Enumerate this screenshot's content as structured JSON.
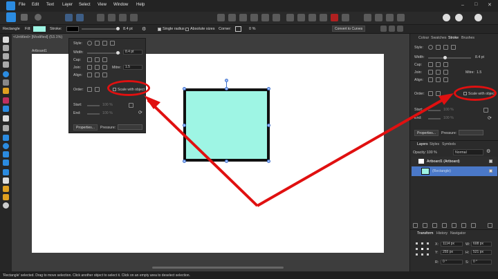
{
  "menu": [
    "File",
    "Edit",
    "Text",
    "Layer",
    "Select",
    "View",
    "Window",
    "Help"
  ],
  "context": {
    "tool": "Rectangle",
    "fill_label": "Fill:",
    "stroke_label": "Stroke:",
    "stroke_width": "8.4 pt",
    "single_radius": "Single radius",
    "absolute_sizes": "Absolute sizes",
    "corner_label": "Corner:",
    "corner_value": "0 %",
    "convert": "Convert to Curves"
  },
  "document": {
    "tab": "<Untitled> [Modified] (53.1%)",
    "artboard_label": "Artboard1"
  },
  "stroke_popup": {
    "style": "Style:",
    "width": "Width:",
    "width_value": "8.4 pt",
    "cap": "Cap:",
    "join": "Join:",
    "mitre": "Mitre:",
    "mitre_value": "1.5",
    "align": "Align:",
    "order": "Order:",
    "scale_with_object": "Scale with object",
    "start": "Start:",
    "end": "End:",
    "start_pct": "100 %",
    "end_pct": "100 %",
    "properties": "Properties...",
    "pressure": "Pressure:"
  },
  "right_panel": {
    "tabs": [
      "Colour",
      "Swatches",
      "Stroke",
      "Brushes"
    ],
    "style": "Style:",
    "width": "Width:",
    "width_value": "8.4 pt",
    "cap": "Cap:",
    "join": "Join:",
    "mitre": "Mitre:",
    "mitre_value": "1.5",
    "align": "Align:",
    "order": "Order:",
    "scale_with_object": "Scale with object",
    "start": "Start:",
    "end": "End:",
    "start_pct": "100 %",
    "end_pct": "100 %",
    "properties": "Properties...",
    "pressure": "Pressure:"
  },
  "layers": {
    "tabs": [
      "Layers",
      "Styles",
      "Symbols"
    ],
    "opacity_label": "Opacity:",
    "opacity_value": "100 %",
    "blend": "Normal",
    "items": [
      "Artboard1 (Artboard)",
      "(Rectangle)"
    ]
  },
  "transform": {
    "tabs": [
      "Transform",
      "History",
      "Navigator"
    ],
    "x": "X:",
    "x_value": "1114 px",
    "y": "Y:",
    "y_value": "255 px",
    "w": "W:",
    "w_value": "608 px",
    "h": "H:",
    "h_value": "521 px",
    "r": "R:",
    "r_value": "0 °",
    "s": "S:",
    "s_value": "0 °"
  },
  "status": "'Rectangle' selected. Drag to move selection. Click another object to select it. Click on an empty area to deselect selection.",
  "colors": {
    "fill": "#9ef5e4",
    "stroke": "#000000",
    "accent": "#3d6ec7",
    "annotation": "#e01010"
  }
}
